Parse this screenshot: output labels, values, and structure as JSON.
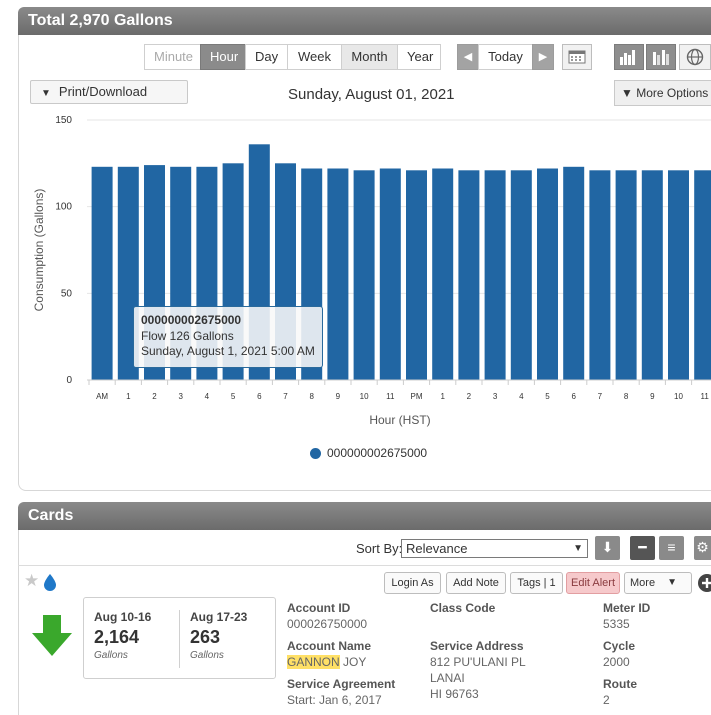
{
  "usage": {
    "title": "Total 2,970 Gallons",
    "periods": [
      "Minute",
      "Hour",
      "Day",
      "Week",
      "Month",
      "Year"
    ],
    "today_label": "Today",
    "print_label": "Print/Download",
    "date_title": "Sunday, August 01, 2021",
    "more_options_label": "▼ More Options"
  },
  "tooltip": {
    "meter": "000000002675000",
    "flow": "Flow 126 Gallons",
    "time": "Sunday, August 1, 2021 5:00 AM"
  },
  "chart_data": {
    "type": "bar",
    "xlabel": "Hour (HST)",
    "ylabel": "Consumption (Gallons)",
    "ylim": [
      0,
      150
    ],
    "yticks": [
      0,
      50,
      100,
      150
    ],
    "categories": [
      "AM",
      "1",
      "2",
      "3",
      "4",
      "5",
      "6",
      "7",
      "8",
      "9",
      "10",
      "11",
      "PM",
      "1",
      "2",
      "3",
      "4",
      "5",
      "6",
      "7",
      "8",
      "9",
      "10",
      "11"
    ],
    "series": [
      {
        "name": "000000002675000",
        "color": "#2166a3",
        "values": [
          123,
          123,
          124,
          123,
          123,
          125,
          136,
          125,
          122,
          122,
          121,
          122,
          121,
          122,
          121,
          121,
          121,
          122,
          123,
          121,
          121,
          121,
          121,
          121
        ]
      }
    ],
    "legend": "bottom-center",
    "grid": true
  },
  "cards": {
    "title": "Cards",
    "sort_by_label": "Sort By:",
    "sort_value": "Relevance",
    "actions": [
      "Login As",
      "Add Note",
      "Tags | 1",
      "Edit Alert",
      "More"
    ],
    "summary": [
      {
        "period": "Aug 10-16",
        "value": "2,164",
        "unit": "Gallons"
      },
      {
        "period": "Aug 17-23",
        "value": "263",
        "unit": "Gallons"
      }
    ],
    "fields": {
      "account_id_label": "Account ID",
      "account_id": "000026750000",
      "account_name_label": "Account Name",
      "account_first": "GANNON",
      "account_last": "JOY",
      "service_agreement_label": "Service Agreement",
      "service_agreement": "Start: Jan 6, 2017",
      "class_code_label": "Class Code",
      "service_address_label": "Service Address",
      "address_1": "812 PU'ULANI PL",
      "address_2": "LANAI",
      "address_3": "HI 96763",
      "meter_id_label": "Meter ID",
      "meter_id": "5335",
      "cycle_label": "Cycle",
      "cycle": "2000",
      "route_label": "Route",
      "route": "2"
    }
  },
  "colors": {
    "bar": "#2166a3",
    "header": "#7a7a7a",
    "alert": "#f6c9cb",
    "arrow": "#3aa82c"
  }
}
